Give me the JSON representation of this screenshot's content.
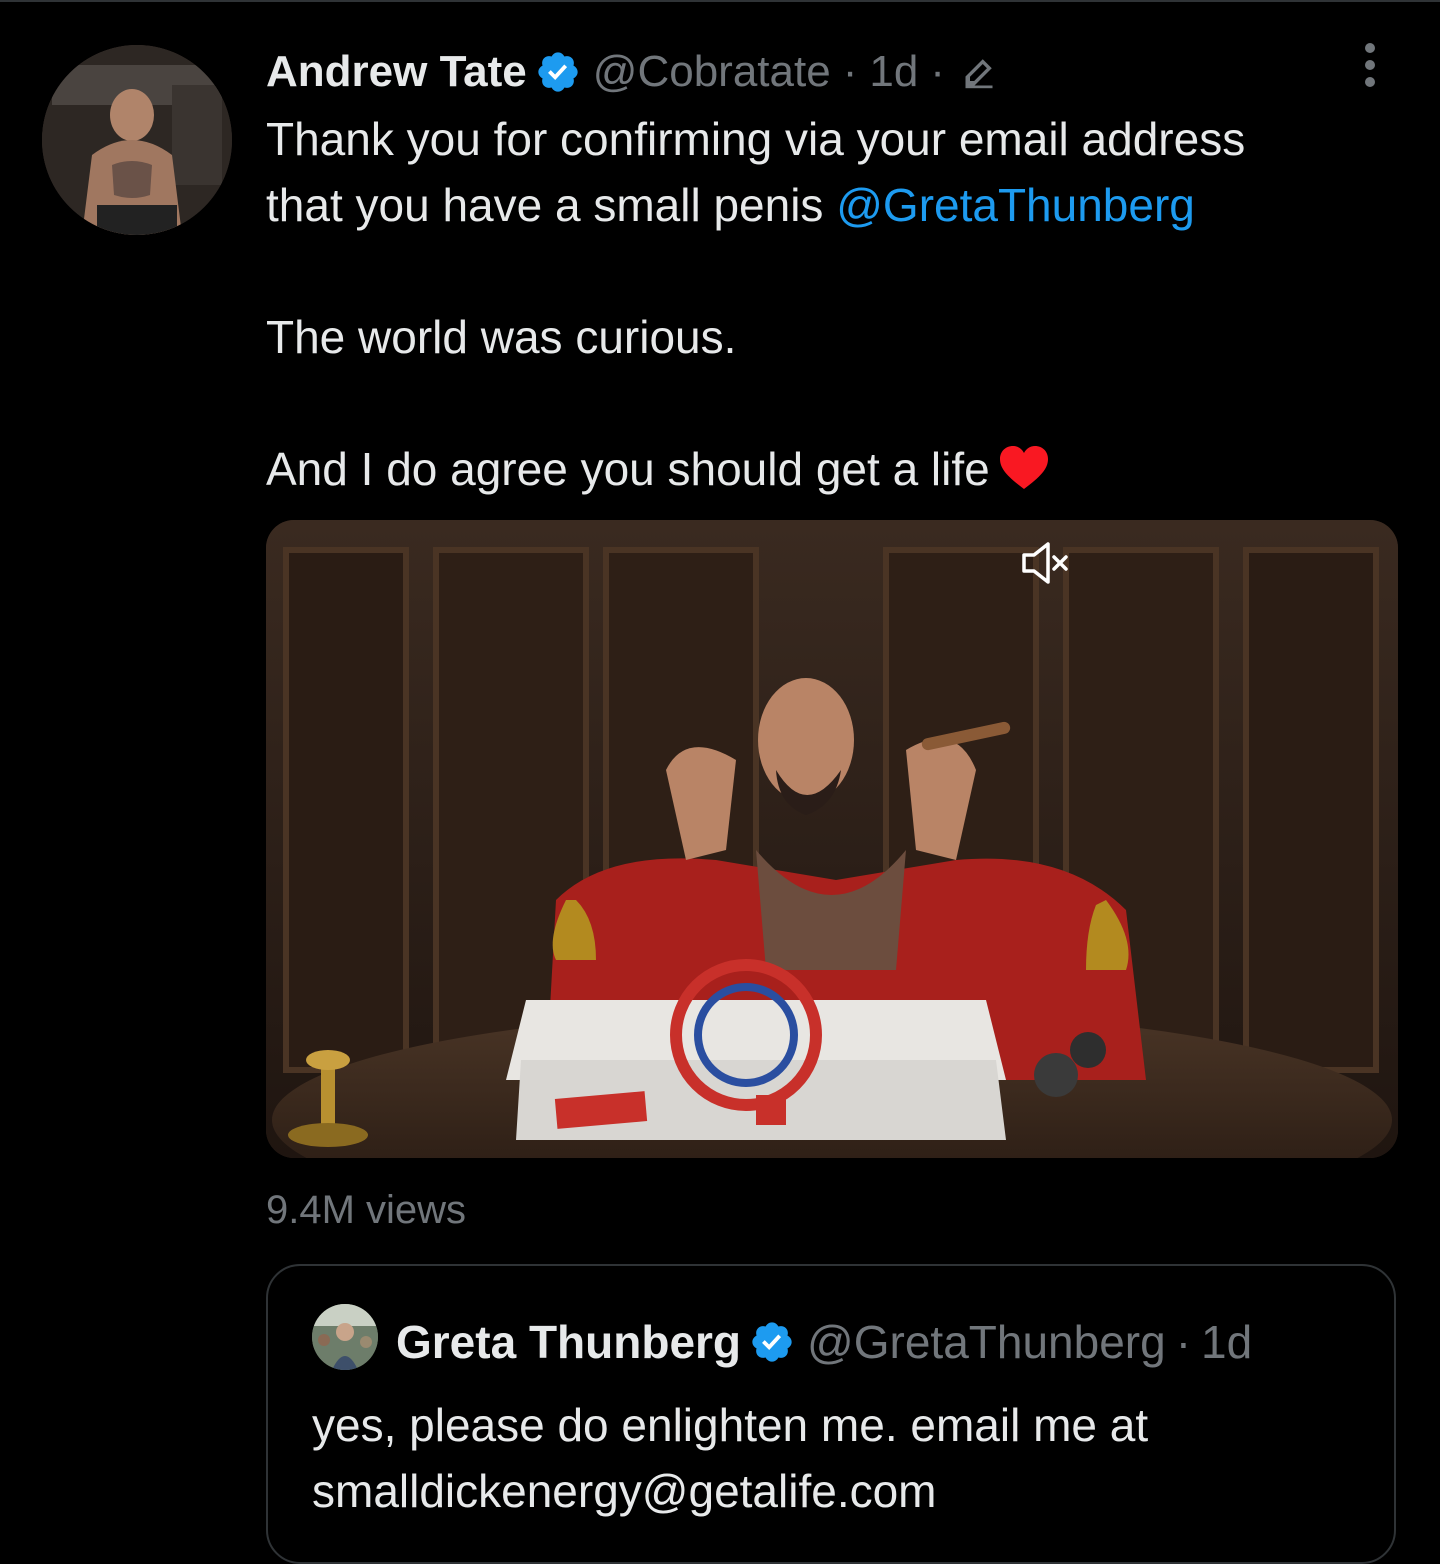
{
  "tweet": {
    "author": {
      "name": "Andrew Tate",
      "handle": "@Cobratate",
      "verified_color": "#1d9bf0"
    },
    "time": "1d",
    "separator": "·",
    "icons": [
      "verified-badge-icon",
      "edit-pencil-icon",
      "more-vertical-icon"
    ],
    "text": {
      "line1": "Thank you for confirming via your email address",
      "line2_prefix": "that you have a small penis ",
      "line2_mention": "@GretaThunberg",
      "para2": "The world was curious.",
      "para3": "And I do agree you should get a life",
      "emoji": "red-heart"
    },
    "media": {
      "type": "video",
      "icons": [
        "mute-speaker-icon"
      ]
    },
    "views": "9.4M views"
  },
  "quoted_tweet": {
    "author": {
      "name": "Greta Thunberg",
      "handle": "@GretaThunberg"
    },
    "time": "1d",
    "separator": "·",
    "text": {
      "line1": "yes, please do enlighten me. email me at",
      "line2": "smalldickenergy@getalife.com"
    }
  },
  "colors": {
    "background": "#000000",
    "text": "#e7e9ea",
    "secondary": "#71767b",
    "link": "#1d9bf0",
    "border": "#2f3336",
    "heart": "#f91880"
  }
}
